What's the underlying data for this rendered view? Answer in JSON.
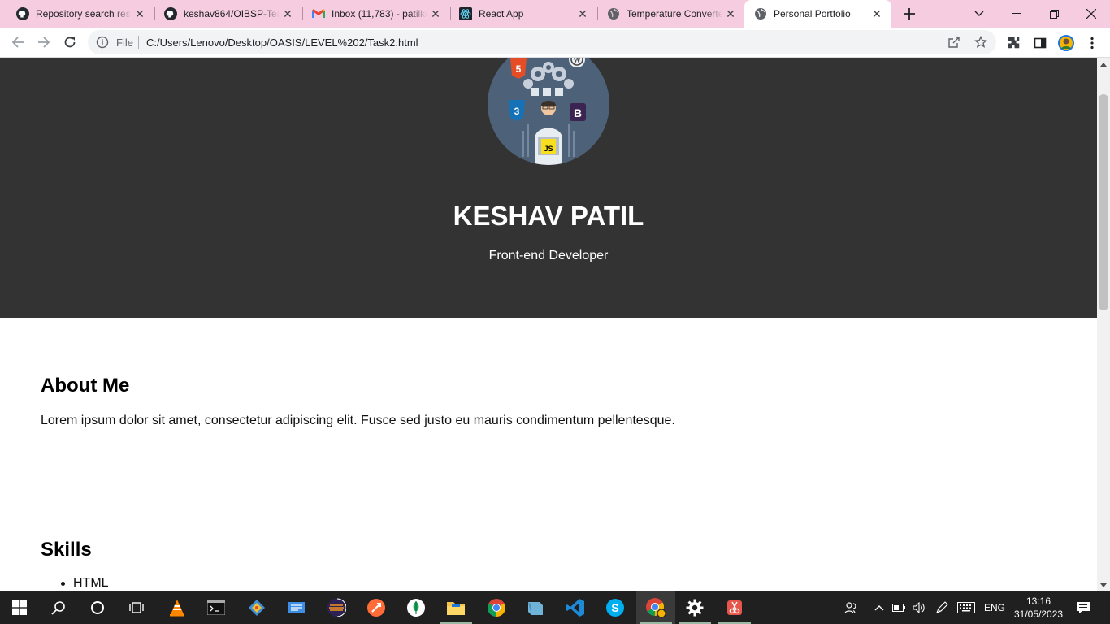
{
  "browser": {
    "tabs": [
      {
        "title": "Repository search results",
        "icon": "github-icon"
      },
      {
        "title": "keshav864/OIBSP-Temperature",
        "icon": "github-icon"
      },
      {
        "title": "Inbox (11,783) - patilkeshav",
        "icon": "gmail-icon"
      },
      {
        "title": "React App",
        "icon": "react-icon"
      },
      {
        "title": "Temperature Converter",
        "icon": "globe-icon"
      },
      {
        "title": "Personal Portfolio",
        "icon": "globe-icon",
        "active": true
      }
    ],
    "omnibox": {
      "scheme_label": "File",
      "url": "C:/Users/Lenovo/Desktop/OASIS/LEVEL%202/Task2.html"
    }
  },
  "page": {
    "hero": {
      "name": "KESHAV PATIL",
      "role": "Front-end Developer",
      "background": "#333333"
    },
    "about": {
      "title": "About Me",
      "text": "Lorem ipsum dolor sit amet, consectetur adipiscing elit. Fusce sed justo eu mauris condimentum pellentesque."
    },
    "skills": {
      "title": "Skills",
      "items": [
        "HTML"
      ]
    }
  },
  "taskbar": {
    "language": "ENG",
    "time": "13:16",
    "date": "31/05/2023"
  },
  "colors": {
    "tabstrip": "#f6cde0",
    "taskbar": "#202020"
  }
}
